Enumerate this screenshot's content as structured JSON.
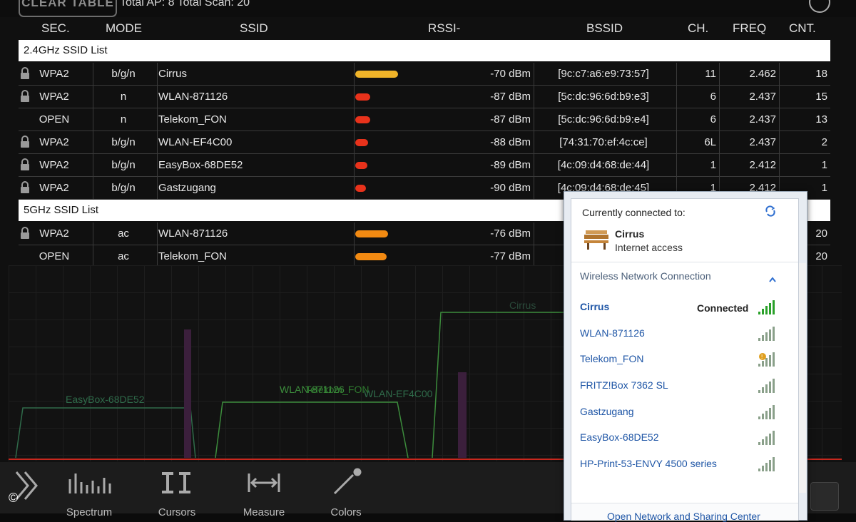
{
  "top": {
    "clear_button": "CLEAR TABLE",
    "totals": "Total AP: 8 Total Scan: 20"
  },
  "headers": [
    "SEC.",
    "MODE",
    "SSID",
    "RSSI-",
    "BSSID",
    "CH.",
    "FREQ",
    "CNT."
  ],
  "sections": [
    {
      "title": "2.4GHz SSID List",
      "rows": [
        {
          "sec": "WPA2",
          "mode": "b/g/n",
          "ssid": "Cirrus",
          "rssi": "-70 dBm",
          "bssid": "[9c:c7:a6:e9:73:57]",
          "ch": "11",
          "freq": "2.462",
          "cnt": "18",
          "locked": true,
          "bar_level": 0.52,
          "bar_color": "#f0b429"
        },
        {
          "sec": "WPA2",
          "mode": "n",
          "ssid": "WLAN-871126",
          "rssi": "-87 dBm",
          "bssid": "[5c:dc:96:6d:b9:e3]",
          "ch": "6",
          "freq": "2.437",
          "cnt": "15",
          "locked": true,
          "bar_level": 0.18,
          "bar_color": "#e8321b"
        },
        {
          "sec": "OPEN",
          "mode": "n",
          "ssid": "Telekom_FON",
          "rssi": "-87 dBm",
          "bssid": "[5c:dc:96:6d:b9:e4]",
          "ch": "6",
          "freq": "2.437",
          "cnt": "13",
          "locked": false,
          "bar_level": 0.18,
          "bar_color": "#e8321b"
        },
        {
          "sec": "WPA2",
          "mode": "b/g/n",
          "ssid": "WLAN-EF4C00",
          "rssi": "-88 dBm",
          "bssid": "[74:31:70:ef:4c:ce]",
          "ch": "6L",
          "freq": "2.437",
          "cnt": "2",
          "locked": true,
          "bar_level": 0.16,
          "bar_color": "#e8321b"
        },
        {
          "sec": "WPA2",
          "mode": "b/g/n",
          "ssid": "EasyBox-68DE52",
          "rssi": "-89 dBm",
          "bssid": "[4c:09:d4:68:de:44]",
          "ch": "1",
          "freq": "2.412",
          "cnt": "1",
          "locked": true,
          "bar_level": 0.15,
          "bar_color": "#e8321b"
        },
        {
          "sec": "WPA2",
          "mode": "b/g/n",
          "ssid": "Gastzugang",
          "rssi": "-90 dBm",
          "bssid": "[4c:09:d4:68:de:45]",
          "ch": "1",
          "freq": "2.412",
          "cnt": "1",
          "locked": true,
          "bar_level": 0.13,
          "bar_color": "#e8321b"
        }
      ]
    },
    {
      "title": "5GHz SSID List",
      "rows": [
        {
          "sec": "WPA2",
          "mode": "ac",
          "ssid": "WLAN-871126",
          "rssi": "-76 dBm",
          "bssid": "[",
          "ch": "",
          "freq": "",
          "cnt": "20",
          "locked": true,
          "bar_level": 0.4,
          "bar_color": "#f28a12"
        },
        {
          "sec": "OPEN",
          "mode": "ac",
          "ssid": "Telekom_FON",
          "rssi": "-77 dBm",
          "bssid": "[",
          "ch": "",
          "freq": "",
          "cnt": "20",
          "locked": false,
          "bar_level": 0.38,
          "bar_color": "#f28a12"
        }
      ]
    }
  ],
  "spectrum_labels": [
    "EasyBox-68DE52",
    "WLAN-871126",
    "Telekom_FON",
    "WLAN-EF4C00",
    "Cirrus"
  ],
  "toolbar": {
    "items": [
      "Spectrum",
      "Cursors",
      "Measure",
      "Colors"
    ],
    "copyright": "©"
  },
  "popup": {
    "title": "Currently connected to:",
    "connected_name": "Cirrus",
    "connected_status": "Internet access",
    "section": "Wireless Network Connection",
    "connected_label": "Connected",
    "networks": [
      "Cirrus",
      "WLAN-871126",
      "Telekom_FON",
      "FRITZ!Box 7362 SL",
      "Gastzugang",
      "EasyBox-68DE52",
      "HP-Print-53-ENVY 4500 series"
    ],
    "footer": "Open Network and Sharing Center"
  }
}
